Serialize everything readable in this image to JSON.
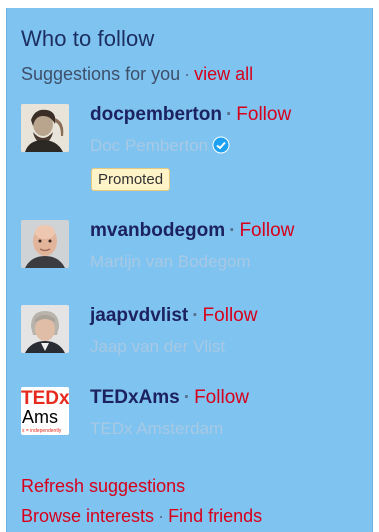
{
  "widget": {
    "title": "Who to follow",
    "subtitle": "Suggestions for you",
    "view_all": "view all",
    "separator": "·"
  },
  "users": [
    {
      "handle": "docpemberton",
      "name": "Doc Pemberton",
      "follow": "Follow",
      "verified": true,
      "badge": "Promoted",
      "avatar_icon": "vintage-portrait-avatar"
    },
    {
      "handle": "mvanbodegom",
      "name": "Martijn van Bodegom",
      "follow": "Follow",
      "verified": false,
      "avatar_icon": "bald-man-avatar"
    },
    {
      "handle": "jaapvdvlist",
      "name": "Jaap van der Vlist",
      "follow": "Follow",
      "verified": false,
      "avatar_icon": "grey-haired-man-avatar"
    },
    {
      "handle": "TEDxAms",
      "name": "TEDx Amsterdam",
      "follow": "Follow",
      "verified": false,
      "avatar_icon": "tedx-logo-avatar",
      "logo_text": [
        "TEDx",
        "Ams",
        "x = independently"
      ]
    }
  ],
  "footer": {
    "refresh": "Refresh suggestions",
    "browse": "Browse interests",
    "find_friends": "Find friends"
  },
  "colors": {
    "panel_bg": "#7fc3f0",
    "title": "#1c2f60",
    "link": "#d7001b",
    "muted": "#a7c9e4",
    "verified": "#1da1f2"
  }
}
